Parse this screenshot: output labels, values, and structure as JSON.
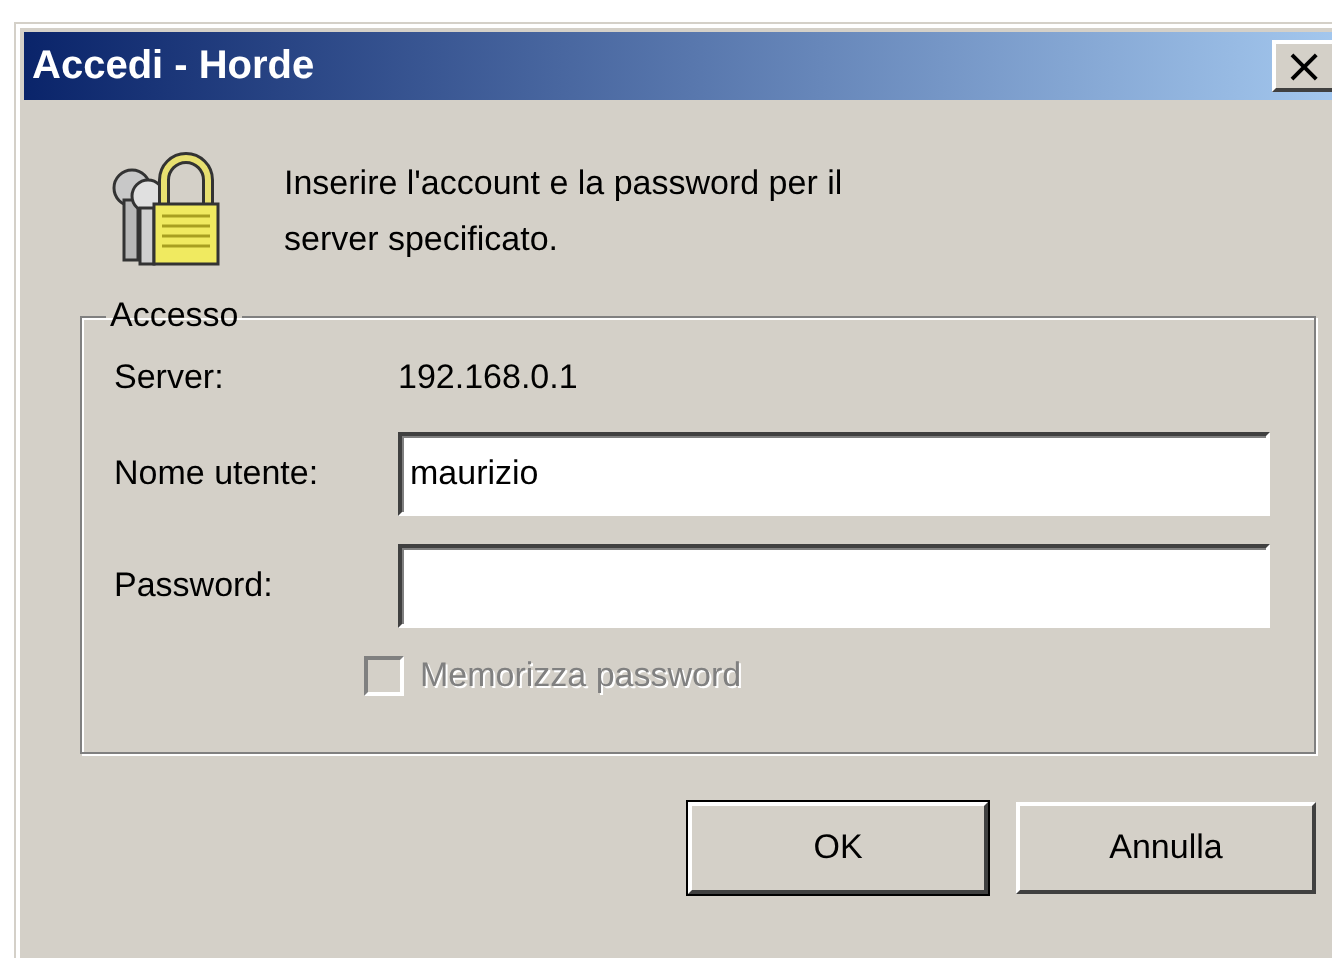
{
  "window": {
    "title": "Accedi - Horde",
    "close": "×"
  },
  "message": "Inserire l'account e la password per il server specificato.",
  "group": {
    "legend": "Accesso",
    "server": {
      "label": "Server:",
      "value": "192.168.0.1"
    },
    "fields": [
      {
        "label": "Nome utente:",
        "value": "maurizio",
        "kind": "text"
      },
      {
        "label": "Password:",
        "kind": "password"
      }
    ],
    "checkbox": {
      "label": "Memorizza password",
      "checked": false,
      "disabled": true
    }
  },
  "buttons": [
    {
      "label": "OK",
      "default": true
    },
    {
      "label": "Annulla",
      "default": false
    }
  ]
}
